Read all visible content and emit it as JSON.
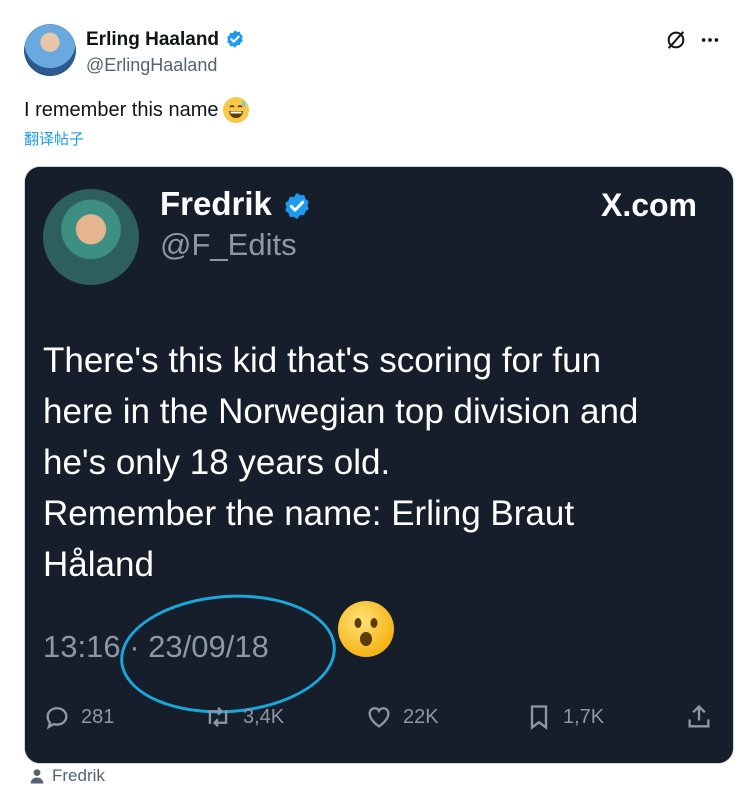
{
  "author": {
    "name": "Erling Haaland",
    "handle": "@ErlingHaaland"
  },
  "post": {
    "text": "I remember this name",
    "emoji": "sweat-smile-emoji",
    "translate_label": "翻译帖子"
  },
  "quoted": {
    "name": "Fredrik",
    "handle": "@F_Edits",
    "brand": "X.com",
    "lines": [
      "There's this kid that's scoring for fun",
      "here in the Norwegian top division and",
      "he's only 18 years old.",
      "Remember the name: Erling Braut",
      "Håland"
    ],
    "time": "13:16",
    "date": "· 23/09/18",
    "stats": {
      "replies": "281",
      "reposts": "3,4K",
      "likes": "22K",
      "bookmarks": "1,7K"
    }
  },
  "footer": {
    "credit": "Fredrik"
  },
  "colors": {
    "accent": "#1d9bf0",
    "card_bg": "#171e2b",
    "annotation": "#1aa6d8"
  }
}
